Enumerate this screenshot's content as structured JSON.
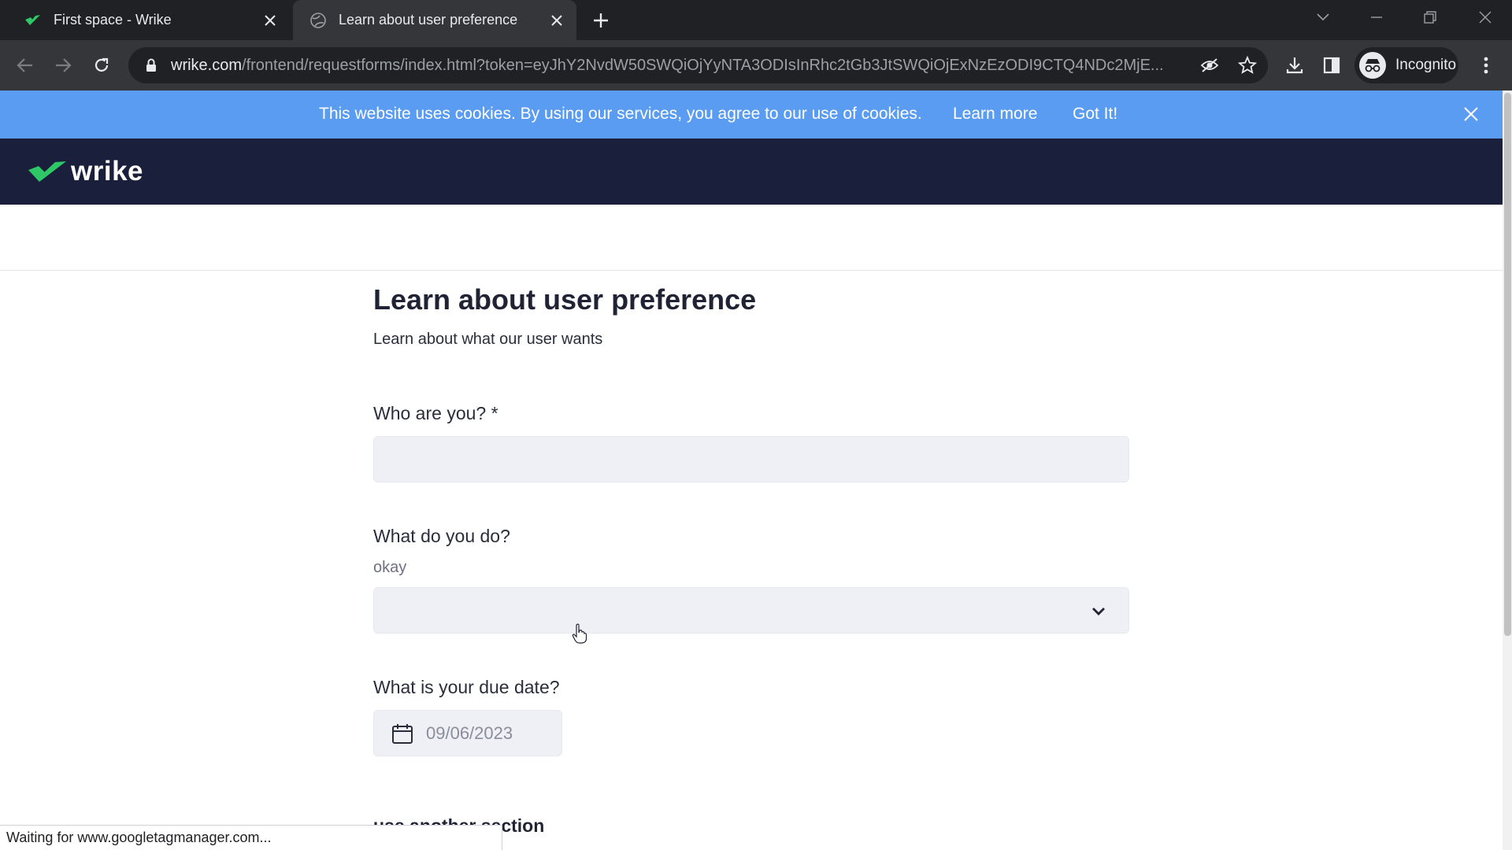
{
  "browser": {
    "tabs": [
      {
        "title": "First space - Wrike",
        "active": false
      },
      {
        "title": "Learn about user preference",
        "active": true
      }
    ],
    "url_host": "wrike.com",
    "url_path": "/frontend/requestforms/index.html?token=eyJhY2NvdW50SWQiOjYyNTA3ODIsInRhc2tGb3JtSWQiOjExNzEzODI9CTQ4NDc2MjE...",
    "profile_label": "Incognito",
    "status_text": "Waiting for www.googletagmanager.com..."
  },
  "cookie_banner": {
    "message": "This website uses cookies. By using our services, you agree to our use of cookies.",
    "learn_more": "Learn more",
    "got_it": "Got It!"
  },
  "header": {
    "logo_text": "wrike"
  },
  "form": {
    "title": "Learn about user preference",
    "description": "Learn about what our user wants",
    "q1_label": "Who are you? *",
    "q1_value": "",
    "q2_label": "What do you do?",
    "q2_hint": "okay",
    "q2_value": "",
    "q3_label": "What is your due date?",
    "q3_value": "09/06/2023",
    "next_section_title": "use another section"
  },
  "colors": {
    "cookie_banner": "#5b9cf3",
    "app_header": "#1a1f3b",
    "brand_green": "#2ec866",
    "field_background": "#eef0f5"
  }
}
